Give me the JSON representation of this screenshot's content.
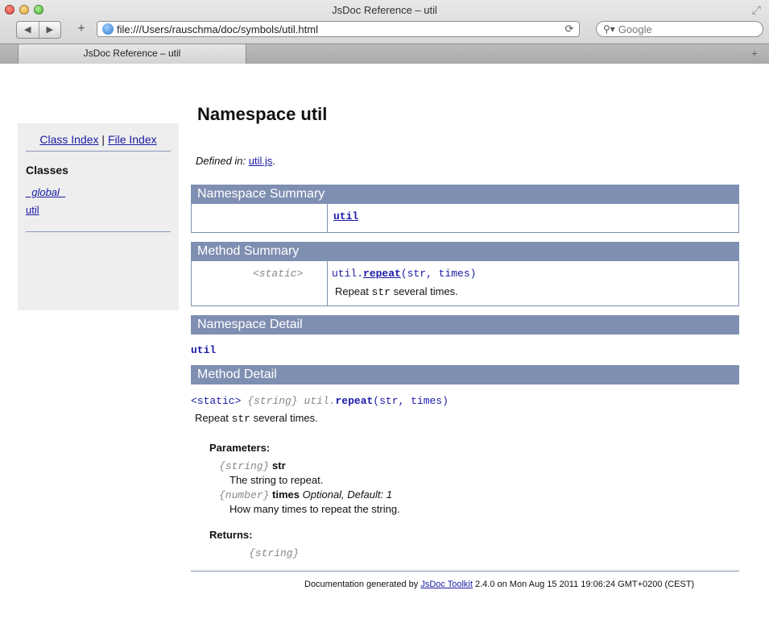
{
  "window": {
    "title": "JsDoc Reference – util"
  },
  "toolbar": {
    "back_label": "◀",
    "forward_label": "▶",
    "new_tab_label": "+",
    "url": "file:///Users/rauschma/doc/symbols/util.html",
    "reload_label": "C",
    "search_placeholder": "Google"
  },
  "tabs": [
    {
      "label": "JsDoc Reference – util"
    }
  ],
  "sidebar": {
    "class_index": "Class Index",
    "separator": "|",
    "file_index": "File Index",
    "classes_heading": "Classes",
    "items": [
      {
        "label": "_global_"
      },
      {
        "label": "util"
      }
    ]
  },
  "page": {
    "title": "Namespace util",
    "defined_label": "Defined in:",
    "defined_file": "util.js",
    "defined_suffix": "."
  },
  "namespace_summary": {
    "heading": "Namespace Summary",
    "link": "util"
  },
  "method_summary": {
    "heading": "Method Summary",
    "modifier": "<static>",
    "prefix": "util.",
    "name": "repeat",
    "params": "(str, times)",
    "desc_before": "Repeat ",
    "desc_code": "str",
    "desc_after": " several times."
  },
  "namespace_detail": {
    "heading": "Namespace Detail",
    "name": "util"
  },
  "method_detail": {
    "heading": "Method Detail",
    "static": "<static>",
    "type": "{string}",
    "prefix": "util.",
    "name": "repeat",
    "params": "(str, times)",
    "desc_before": "Repeat ",
    "desc_code": "str",
    "desc_after": " several times.",
    "parameters_heading": "Parameters:",
    "parameters": [
      {
        "type": "{string}",
        "name": "str",
        "extra": "",
        "desc": "The string to repeat."
      },
      {
        "type": "{number}",
        "name": "times",
        "extra": "Optional, Default: 1",
        "desc": "How many times to repeat the string."
      }
    ],
    "returns_heading": "Returns:",
    "returns_type": "{string}"
  },
  "footer": {
    "before": "Documentation generated by ",
    "link": "JsDoc Toolkit",
    "after": " 2.4.0 on Mon Aug 15 2011 19:06:24 GMT+0200 (CEST)"
  }
}
